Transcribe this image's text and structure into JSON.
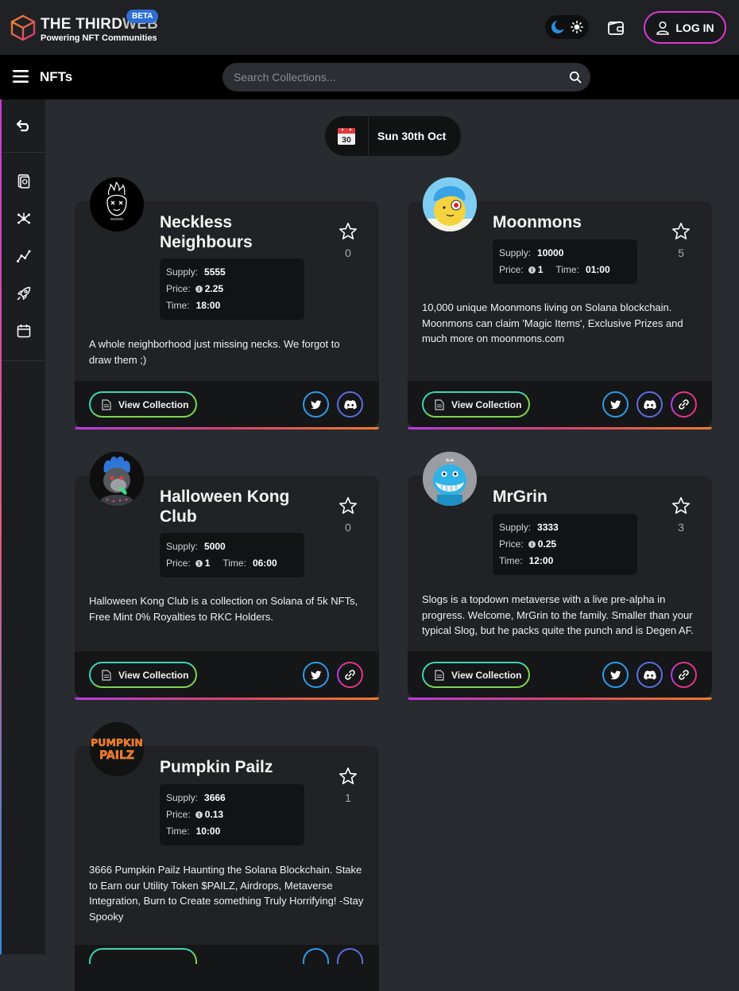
{
  "header": {
    "brand_the": "THE THIRD",
    "brand_web": "WEB",
    "tagline": "Powering NFT Communities",
    "beta": "BETA",
    "login": "LOG IN"
  },
  "navbar": {
    "title": "NFTs",
    "search_placeholder": "Search Collections..."
  },
  "date": {
    "calendar_day": "30",
    "label": "Sun 30th Oct"
  },
  "cards": [
    {
      "name_line1": "Neckless",
      "name_line2": "Neighbours",
      "supply": "5555",
      "price": "2.25",
      "time": "18:00",
      "stars": "0",
      "description": "A whole neighborhood just missing necks. We forgot to draw them ;)",
      "view_label": "View Collection",
      "socials": [
        "twitter",
        "discord"
      ]
    },
    {
      "name_line1": "Moonmons",
      "supply": "10000",
      "price": "1",
      "time": "01:00",
      "stars": "5",
      "description": "10,000 unique Moonmons living on Solana blockchain. Moonmons can claim 'Magic Items', Exclusive Prizes and much more on moonmons.com",
      "view_label": "View Collection",
      "socials": [
        "twitter",
        "discord",
        "link"
      ]
    },
    {
      "name_line1": "Halloween Kong",
      "name_line2": "Club",
      "supply": "5000",
      "price": "1",
      "time": "06:00",
      "stars": "0",
      "description": "Halloween Kong Club is a collection on Solana of 5k NFTs, Free Mint 0% Royalties to RKC Holders.",
      "view_label": "View Collection",
      "socials": [
        "twitter",
        "link"
      ]
    },
    {
      "name_line1": "MrGrin",
      "supply": "3333",
      "price": "0.25",
      "time": "12:00",
      "stars": "3",
      "description": "Slogs is a topdown metaverse with a live pre-alpha in progress. Welcome, MrGrin to the family. Smaller than your typical Slog, but he packs quite the punch and is Degen AF.",
      "view_label": "View Collection",
      "socials": [
        "twitter",
        "discord",
        "link"
      ]
    },
    {
      "name_line1": "Pumpkin Pailz",
      "supply": "3666",
      "price": "0.13",
      "time": "10:00",
      "stars": "1",
      "description": "3666 Pumpkin Pailz Haunting the Solana Blockchain. Stake to Earn our Utility Token $PAILZ, Airdrops, Metaverse Integration, Burn to Create something Truly Horrifying! -Stay Spooky",
      "avatar_text": "PUMPKIN PAILZ"
    }
  ],
  "labels": {
    "supply": "Supply:",
    "price": "Price:",
    "time": "Time:"
  }
}
